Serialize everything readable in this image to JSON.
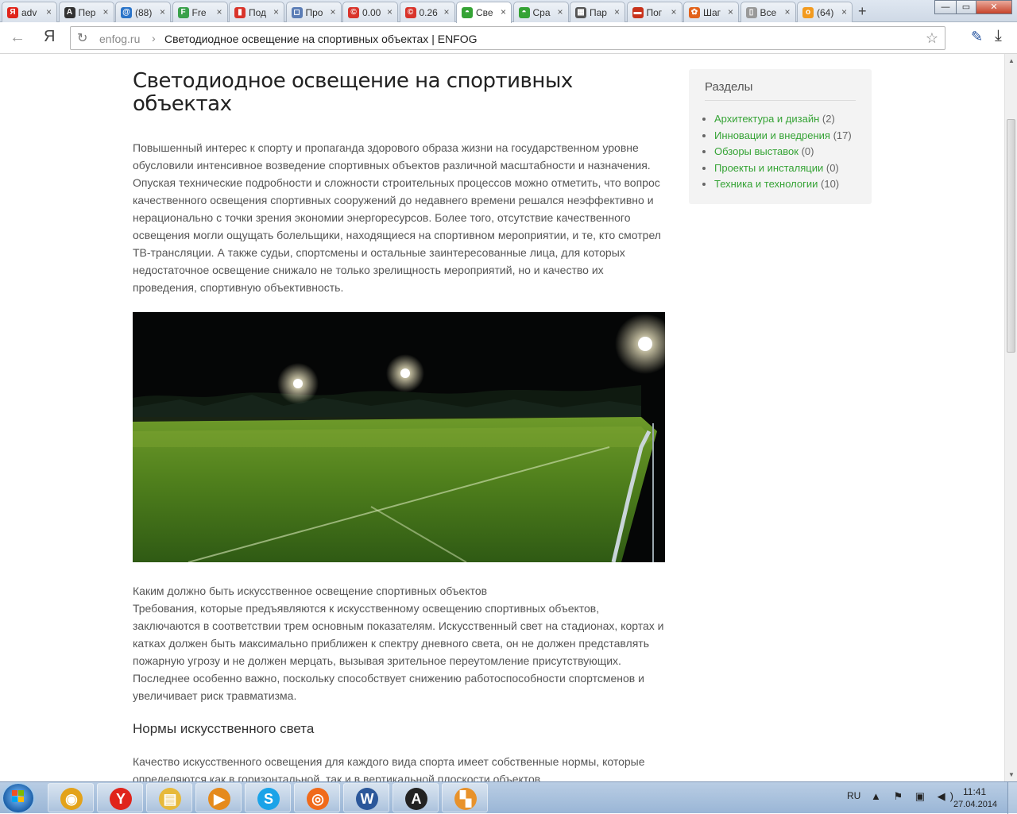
{
  "browser": {
    "tabs": [
      {
        "label": "adv",
        "favicon": "Я",
        "color": "#e0241b"
      },
      {
        "label": "Пер",
        "favicon": "A",
        "color": "#333333"
      },
      {
        "label": "(88)",
        "favicon": "@",
        "color": "#2a74c9"
      },
      {
        "label": "Fre",
        "favicon": "F",
        "color": "#3aa14b"
      },
      {
        "label": "Под",
        "favicon": "▮",
        "color": "#d9342b"
      },
      {
        "label": "Про",
        "favicon": "◻",
        "color": "#5b7db6"
      },
      {
        "label": "0.00",
        "favicon": "©",
        "color": "#d9342b"
      },
      {
        "label": "0.26",
        "favicon": "©",
        "color": "#d9342b"
      },
      {
        "label": "Све",
        "favicon": "◓",
        "color": "#35a335",
        "active": true
      },
      {
        "label": "Сра",
        "favicon": "◓",
        "color": "#35a335"
      },
      {
        "label": "Пар",
        "favicon": "▦",
        "color": "#555555"
      },
      {
        "label": "Пог",
        "favicon": "▬",
        "color": "#c8321b"
      },
      {
        "label": "Шаг",
        "favicon": "✿",
        "color": "#e2621b"
      },
      {
        "label": "Все",
        "favicon": "▯",
        "color": "#999999"
      },
      {
        "label": "(64)",
        "favicon": "о",
        "color": "#f29a1f"
      }
    ],
    "new_tab": "+",
    "window_buttons": {
      "minimize": "—",
      "maximize": "▭",
      "close": "✕"
    },
    "address": {
      "domain": "enfog.ru",
      "separator": "›",
      "title": "Светодиодное освещение на спортивных объектах | ENFOG"
    },
    "icons": {
      "back": "←",
      "yandex": "Я",
      "reload": "↻",
      "star": "☆",
      "pencil": "✎",
      "download": "⤓"
    }
  },
  "article": {
    "title": "Светодиодное освещение на спортивных объектах",
    "intro": "Повышенный интерес к спорту и пропаганда здорового образа жизни на государственном уровне обусловили интенсивное возведение спортивных объектов различной масштабности и назначения. Опуская технические подробности и сложности строительных процессов можно отметить, что вопрос качественного освещения спортивных сооружений до недавнего времени решался неэффективно и нерационально с точки зрения экономии энергоресурсов. Более того, отсутствие качественного освещения могли ощущать болельщики, находящиеся на спортивном мероприятии, и те, кто смотрел ТВ-трансляции. А также судьи, спортсмены и остальные заинтересованные лица, для которых недостаточное освещение снижало не только зрелищность мероприятий, но и качество их проведения, спортивную объективность.",
    "section1_heading": "Каким должно быть искусственное освещение спортивных объектов",
    "section1_text": "Требования, которые предъявляются к искусственному освещению спортивных объектов, заключаются в соответствии трем основным показателям. Искусственный свет на стадионах, кортах и катках должен быть максимально приближен к спектру дневного света, он не должен представлять пожарную угрозу и не должен мерцать, вызывая зрительное переутомление присутствующих. Последнее особенно важно, поскольку способствует снижению работоспособности спортсменов и увеличивает риск травматизма.",
    "section2_heading": "Нормы искусственного света",
    "section2_text": "Качество искусственного освещения для каждого вида спорта имеет собственные нормы, которые определяются как в горизонтальной, так и в вертикальной плоскости объектов."
  },
  "sidebar": {
    "title": "Разделы",
    "items": [
      {
        "label": "Архитектура и дизайн",
        "count": "(2)"
      },
      {
        "label": "Инновации и внедрения",
        "count": "(17)"
      },
      {
        "label": "Обзоры выставок",
        "count": "(0)"
      },
      {
        "label": "Проекты и инсталяции",
        "count": "(0)"
      },
      {
        "label": "Техника и технологии",
        "count": "(10)"
      }
    ]
  },
  "taskbar": {
    "apps": [
      {
        "name": "chrome",
        "glyph": "◉",
        "color": "#e3a21a"
      },
      {
        "name": "yandex-browser",
        "glyph": "Y",
        "color": "#e0241b"
      },
      {
        "name": "explorer",
        "glyph": "▤",
        "color": "#e7b93a"
      },
      {
        "name": "media-player",
        "glyph": "▶",
        "color": "#e58a1c"
      },
      {
        "name": "skype",
        "glyph": "S",
        "color": "#1aa3e8"
      },
      {
        "name": "origin",
        "glyph": "◎",
        "color": "#f06a1b"
      },
      {
        "name": "word",
        "glyph": "W",
        "color": "#2b579a"
      },
      {
        "name": "font-viewer",
        "glyph": "A",
        "color": "#222222"
      },
      {
        "name": "app-9",
        "glyph": "▚",
        "color": "#e8922b"
      }
    ],
    "lang": "RU",
    "tray": "▲ ⚑ ▣ ◀)",
    "time": "11:41",
    "date": "27.04.2014"
  }
}
